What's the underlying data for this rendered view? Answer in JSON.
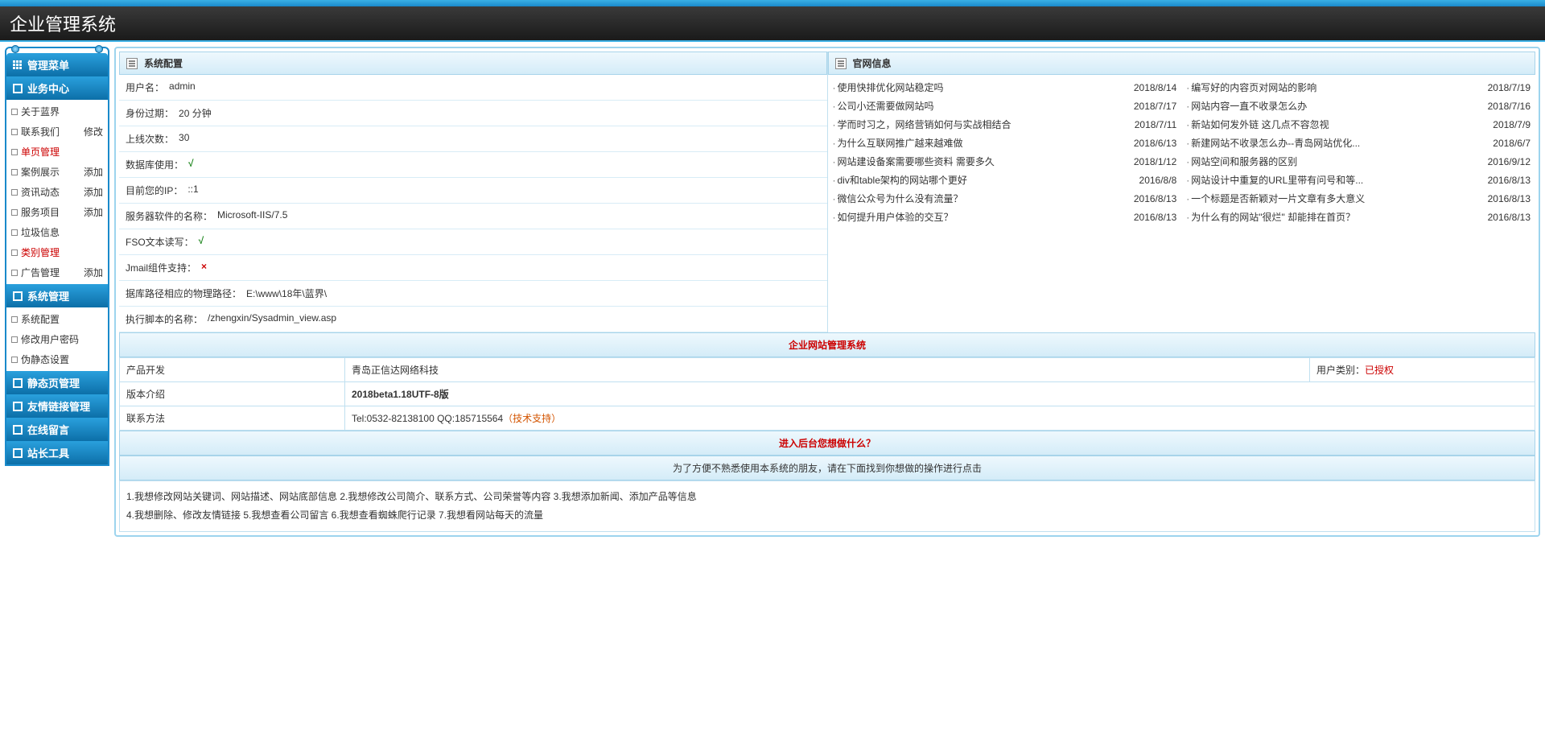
{
  "header": {
    "title": "企业管理系统"
  },
  "sidebar": {
    "menuTitle": "管理菜单",
    "groups": [
      {
        "title": "业务中心",
        "items": [
          {
            "label": "关于蓝界",
            "red": false,
            "extra": ""
          },
          {
            "label": "联系我们",
            "red": false,
            "extra": "修改"
          },
          {
            "label": "单页管理",
            "red": true,
            "extra": ""
          },
          {
            "label": "案例展示",
            "red": false,
            "extra": "添加"
          },
          {
            "label": "资讯动态",
            "red": false,
            "extra": "添加"
          },
          {
            "label": "服务项目",
            "red": false,
            "extra": "添加"
          },
          {
            "label": "垃圾信息",
            "red": false,
            "extra": ""
          },
          {
            "label": "类别管理",
            "red": true,
            "extra": ""
          },
          {
            "label": "广告管理",
            "red": false,
            "extra": "添加"
          }
        ]
      },
      {
        "title": "系统管理",
        "items": [
          {
            "label": "系统配置",
            "red": false,
            "extra": ""
          },
          {
            "label": "修改用户密码",
            "red": false,
            "extra": ""
          },
          {
            "label": "伪静态设置",
            "red": false,
            "extra": ""
          }
        ]
      }
    ],
    "bars": [
      "静态页管理",
      "友情链接管理",
      "在线留言",
      "站长工具"
    ]
  },
  "sysconfig": {
    "title": "系统配置",
    "rows": [
      {
        "k": "用户名：",
        "v": "admin"
      },
      {
        "k": "身份过期：",
        "v": "20 分钟"
      },
      {
        "k": "上线次数：",
        "v": "30"
      },
      {
        "k": "数据库使用：",
        "v": "√",
        "type": "check"
      },
      {
        "k": "目前您的IP：",
        "v": "::1"
      },
      {
        "k": "服务器软件的名称：",
        "v": "Microsoft-IIS/7.5"
      },
      {
        "k": "FSO文本读写：",
        "v": "√",
        "type": "check"
      },
      {
        "k": "Jmail组件支持：",
        "v": "×",
        "type": "cross"
      },
      {
        "k": "据库路径相应的物理路径：",
        "v": "E:\\www\\18年\\蓝界\\"
      },
      {
        "k": "执行脚本的名称：",
        "v": "/zhengxin/Sysadmin_view.asp"
      }
    ]
  },
  "siteinfo": {
    "title": "官网信息",
    "left": [
      {
        "t": "使用快排优化网站稳定吗",
        "d": "2018/8/14"
      },
      {
        "t": "公司小还需要做网站吗",
        "d": "2018/7/17"
      },
      {
        "t": "学而时习之，网络营销如何与实战相结合",
        "d": "2018/7/11"
      },
      {
        "t": "为什么互联网推广越来越难做",
        "d": "2018/6/13"
      },
      {
        "t": "网站建设备案需要哪些资料 需要多久",
        "d": "2018/1/12"
      },
      {
        "t": "div和table架构的网站哪个更好",
        "d": "2016/8/8"
      },
      {
        "t": "微信公众号为什么没有流量？",
        "d": "2016/8/13"
      },
      {
        "t": "如何提升用户体验的交互？",
        "d": "2016/8/13"
      }
    ],
    "right": [
      {
        "t": "编写好的内容页对网站的影响",
        "d": "2018/7/19"
      },
      {
        "t": "网站内容一直不收录怎么办",
        "d": "2018/7/16"
      },
      {
        "t": "新站如何发外链 这几点不容忽视",
        "d": "2018/7/9"
      },
      {
        "t": "新建网站不收录怎么办--青岛网站优化...",
        "d": "2018/6/7"
      },
      {
        "t": "网站空间和服务器的区别",
        "d": "2016/9/12"
      },
      {
        "t": "网站设计中重复的URL里带有问号和等...",
        "d": "2016/8/13"
      },
      {
        "t": "一个标题是否新颖对一片文章有多大意义",
        "d": "2016/8/13"
      },
      {
        "t": "为什么有的网站\"很烂\" 却能排在首页？",
        "d": "2016/8/13"
      }
    ]
  },
  "product": {
    "barTitle": "企业网站管理系统",
    "rows": [
      {
        "label": "产品开发",
        "value": "青岛正信达网络科技",
        "rlabel": "用户类别：",
        "rvalue": "已授权"
      },
      {
        "label": "版本介绍",
        "value": "2018beta1.18UTF-8版",
        "bold": true
      },
      {
        "label": "联系方法",
        "value": "Tel:0532-82138100 QQ:185715564",
        "suffix": "（技术支持）"
      }
    ]
  },
  "help": {
    "barTitle": "进入后台您想做什么？",
    "subtitle": "为了方便不熟悉使用本系统的朋友，请在下面找到你想做的操作进行点击",
    "line1": "1.我想修改网站关键词、网站描述、网站底部信息 2.我想修改公司简介、联系方式、公司荣誉等内容 3.我想添加新闻、添加产品等信息",
    "line2": "4.我想删除、修改友情链接 5.我想查看公司留言 6.我想查看蜘蛛爬行记录 7.我想看网站每天的流量"
  }
}
